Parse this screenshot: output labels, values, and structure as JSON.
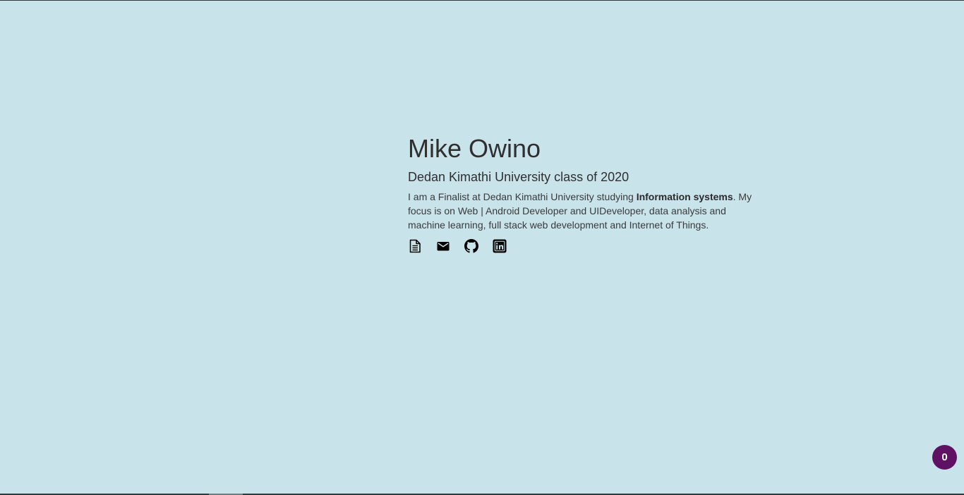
{
  "profile": {
    "name": "Mike Owino",
    "subtitle": "Dedan Kimathi University class of 2020",
    "bio_intro": "I am a Finalist at Dedan Kimathi University studying ",
    "bio_highlight": "Information systems",
    "bio_rest": ". My focus is on Web | Android Developer and UIDeveloper, data analysis and machine learning, full stack web development and Internet of Things."
  },
  "links": [
    {
      "icon": "document-icon"
    },
    {
      "icon": "mail-icon"
    },
    {
      "icon": "github-icon"
    },
    {
      "icon": "linkedin-icon"
    }
  ],
  "badge": {
    "count": "0",
    "color": "#5f1263"
  },
  "colors": {
    "background": "#c9e3ea",
    "text": "#333333"
  }
}
